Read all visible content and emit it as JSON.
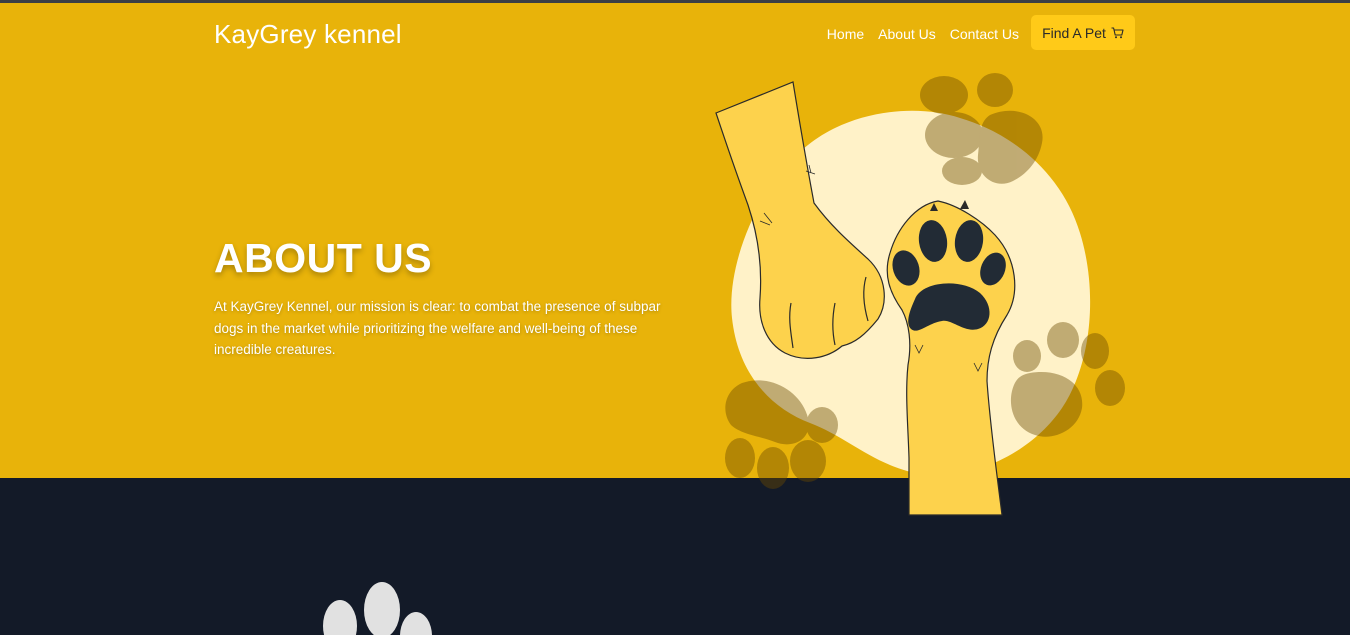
{
  "brand": {
    "name": "KayGrey kennel"
  },
  "nav": {
    "links": [
      {
        "label": "Home"
      },
      {
        "label": "About Us"
      },
      {
        "label": "Contact Us"
      }
    ],
    "cta": {
      "label": "Find A Pet",
      "icon": "cart-icon"
    }
  },
  "hero": {
    "title": "ABOUT US",
    "description": "At KayGrey Kennel, our mission is clear: to combat the presence of subpar dogs in the market while prioritizing the welfare and well-being of these incredible creatures.",
    "illustration": "dog-paws-high-five-illustration"
  },
  "colors": {
    "hero_background": "#e8b30a",
    "lower_background": "#131a28",
    "cta_background": "#ffca18",
    "paw_fill": "#fdd24c",
    "paw_pad": "#222b35"
  }
}
